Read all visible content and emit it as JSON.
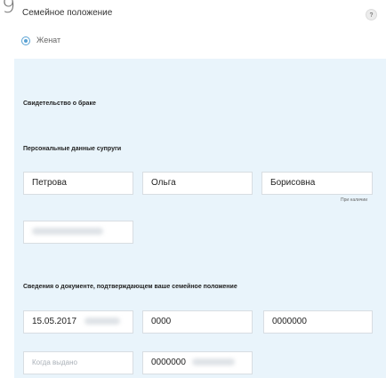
{
  "section": {
    "number": "9",
    "title": "Семейное положение",
    "help_label": "?"
  },
  "marital_status": {
    "selected": "Женат"
  },
  "marriage_certificate": {
    "heading": "Свидетельство о браке"
  },
  "spouse": {
    "heading": "Персональные данные супруги",
    "last_name": "Петрова",
    "first_name": "Ольга",
    "patronymic": "Борисовна",
    "patronymic_hint": "При наличии"
  },
  "document": {
    "heading": "Сведения о документе, подтверждающем ваше семейное положение",
    "date": "15.05.2017",
    "series": "0000",
    "number": "0000000",
    "issued_by_placeholder": "Когда выдано",
    "record_number": "0000000"
  }
}
